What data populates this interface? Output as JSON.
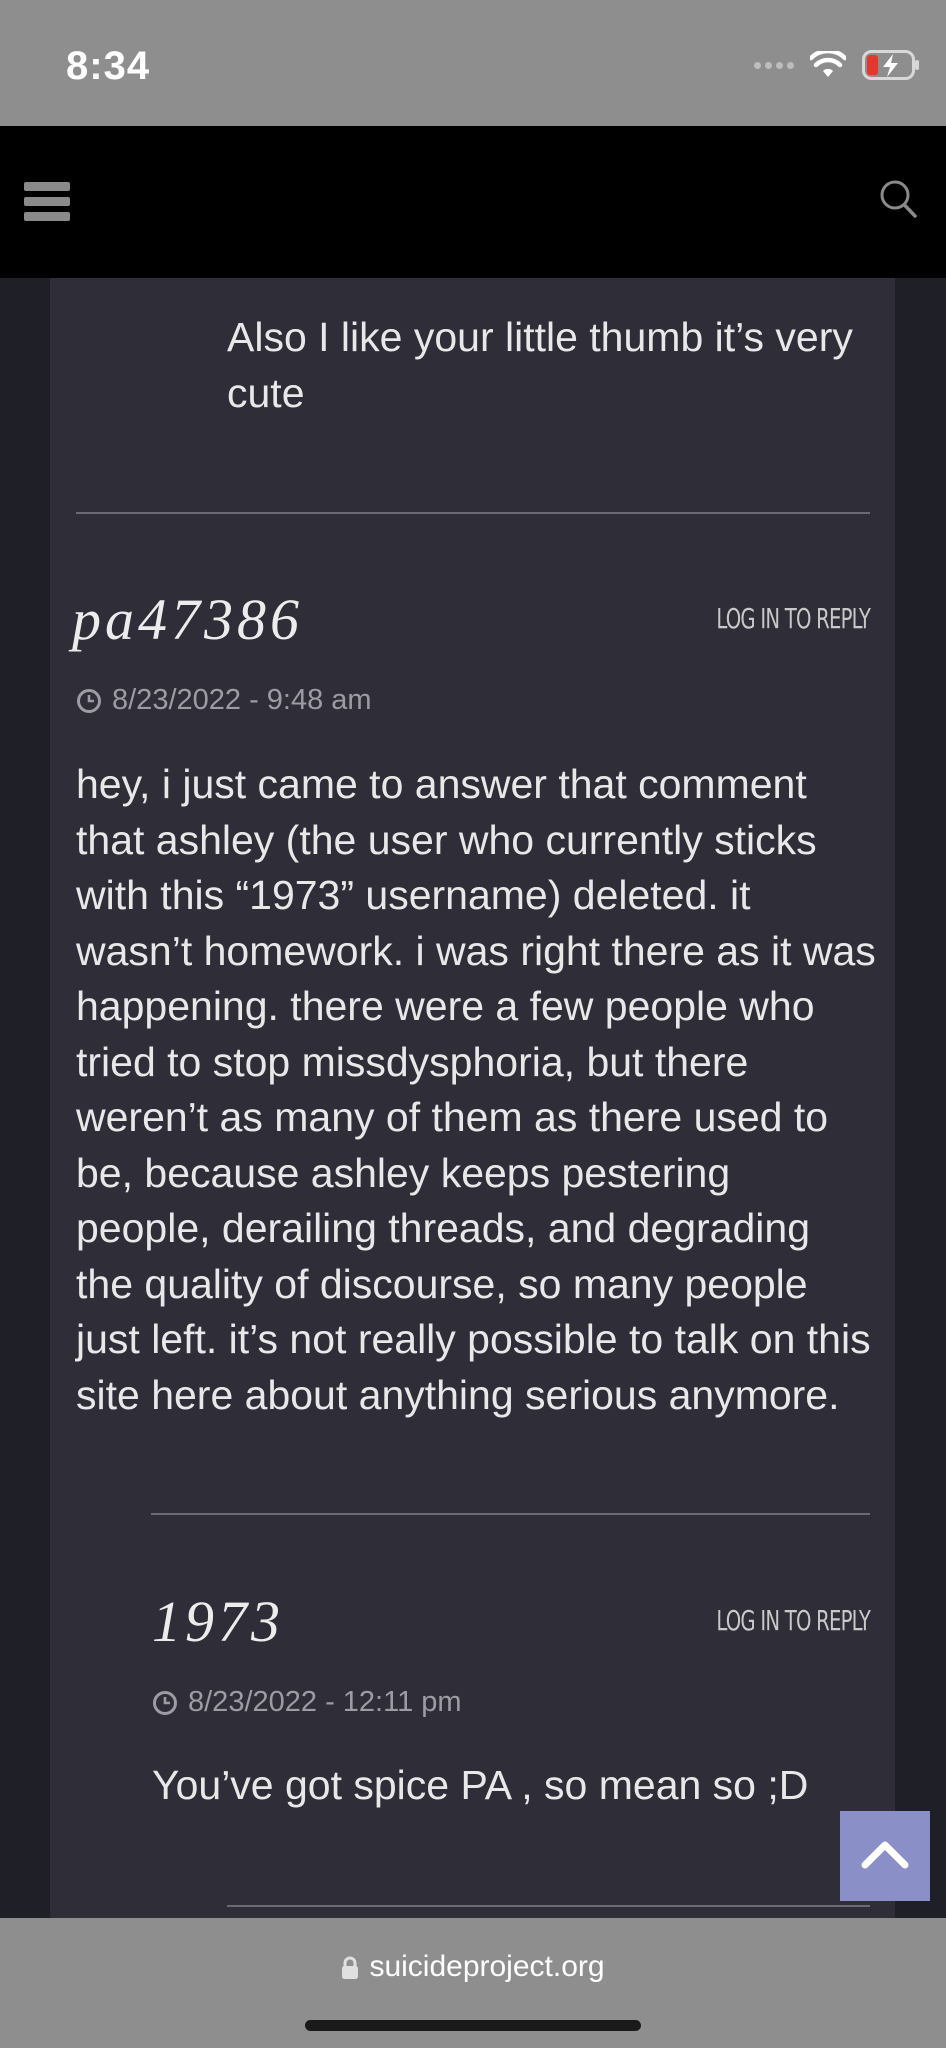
{
  "status": {
    "time": "8:34"
  },
  "comments": {
    "prev_tail": "Also I like your little thumb it’s very cute",
    "main": {
      "username": "pa47386",
      "reply": "LOG IN TO REPLY",
      "timestamp": "8/23/2022 - 9:48 am",
      "body": "hey, i just came to answer that comment that ashley (the user who currently sticks with this “1973” username) deleted. it wasn’t homework. i was right there as it was happening. there were a few people who tried to stop missdysphoria, but there weren’t as many of them as there used to be, because ashley keeps pestering people, derailing threads, and degrading the quality of discourse, so many people just left. it’s not really possible to talk on this site here about anything serious anymore."
    },
    "reply1": {
      "username": "1973",
      "reply": "LOG IN TO REPLY",
      "timestamp": "8/23/2022 - 12:11 pm",
      "body": "You’ve got spice PA , so mean so ;D"
    }
  },
  "browser": {
    "url": "suicideproject.org"
  },
  "icons": {
    "menu": "hamburger-icon",
    "search": "search-icon",
    "clock": "clock-icon",
    "back_to_top": "chevron-up-icon",
    "lock": "lock-icon"
  },
  "colors": {
    "accent": "#8a8fc8",
    "card": "#2e2d38",
    "navbar": "#000000"
  }
}
